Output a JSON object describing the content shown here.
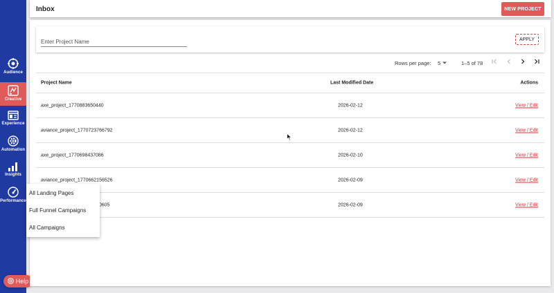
{
  "sidebar": {
    "items": [
      {
        "label": "Audience",
        "icon": "audience-icon"
      },
      {
        "label": "Creative",
        "icon": "creative-icon",
        "active": true
      },
      {
        "label": "Experience",
        "icon": "experience-icon"
      },
      {
        "label": "Automation",
        "icon": "automation-icon"
      },
      {
        "label": "Insights",
        "icon": "insights-icon"
      },
      {
        "label": "Performance",
        "icon": "performance-icon"
      }
    ],
    "help_label": "Help"
  },
  "header": {
    "title": "Inbox",
    "new_project_label": "NEW PROJECT"
  },
  "filter": {
    "placeholder": "Enter Project Name",
    "apply_label": "APPLY"
  },
  "pagination": {
    "rows_per_page_label": "Rows per page:",
    "rows_per_page_value": "5",
    "range_label": "1–5 of 78"
  },
  "table": {
    "headers": {
      "name": "Project Name",
      "date": "Last Modified Date",
      "actions": "Actions"
    },
    "rows": [
      {
        "name": "axe_project_1770883650440",
        "date": "2026-02-12",
        "action": "View / Edit"
      },
      {
        "name": "aviance_project_1770723766792",
        "date": "2026-02-12",
        "action": "View / Edit"
      },
      {
        "name": "axe_project_1770698437086",
        "date": "2026-02-10",
        "action": "View / Edit"
      },
      {
        "name": "aviance_project_1770662156526",
        "date": "2026-02-09",
        "action": "View / Edit"
      },
      {
        "name": "60605",
        "date": "2026-02-09",
        "action": "View / Edit"
      }
    ]
  },
  "submenu": {
    "items": [
      "All Landing Pages",
      "Full Funnel Campaigns",
      "All Campaigns"
    ]
  },
  "colors": {
    "sidebar": "#1f3aa0",
    "accent": "#e05a5a",
    "link": "#d33"
  }
}
